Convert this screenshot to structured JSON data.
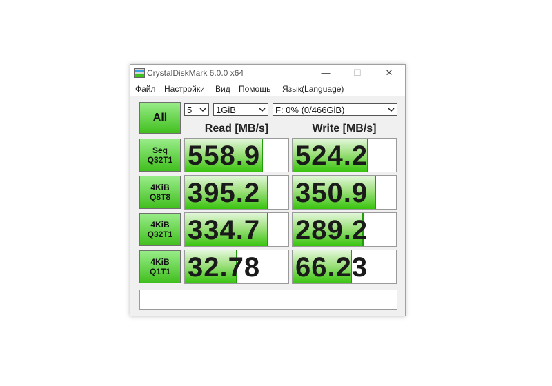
{
  "window": {
    "title": "CrystalDiskMark 6.0.0 x64",
    "minimize_glyph": "—",
    "maximize_glyph": "☐",
    "close_glyph": "✕"
  },
  "menu": [
    "Файл",
    "Настройки",
    "Вид",
    "Помощь",
    "Язык(Language)"
  ],
  "controls": {
    "all_label": "All",
    "count_value": "5",
    "size_value": "1GiB",
    "drive_value": "F: 0% (0/466GiB)"
  },
  "headers": {
    "read": "Read [MB/s]",
    "write": "Write [MB/s]"
  },
  "tests": [
    {
      "line1": "Seq",
      "line2": "Q32T1",
      "read": "558.9",
      "write": "524.2",
      "read_level": 0.74,
      "write_level": 0.72
    },
    {
      "line1": "4KiB",
      "line2": "Q8T8",
      "read": "395.2",
      "write": "350.9",
      "read_level": 0.79,
      "write_level": 0.79
    },
    {
      "line1": "4KiB",
      "line2": "Q32T1",
      "read": "334.7",
      "write": "289.2",
      "read_level": 0.79,
      "write_level": 0.67
    },
    {
      "line1": "4KiB",
      "line2": "Q1T1",
      "read": "32.78",
      "write": "66.23",
      "read_level": 0.49,
      "write_level": 0.56
    }
  ],
  "comment": "",
  "colors": {
    "accent_green": "#41bf1e",
    "bar_border": "#1f9e0a"
  },
  "icons": {
    "app": "disk-icon",
    "dropdown": "chevron-down-icon"
  }
}
